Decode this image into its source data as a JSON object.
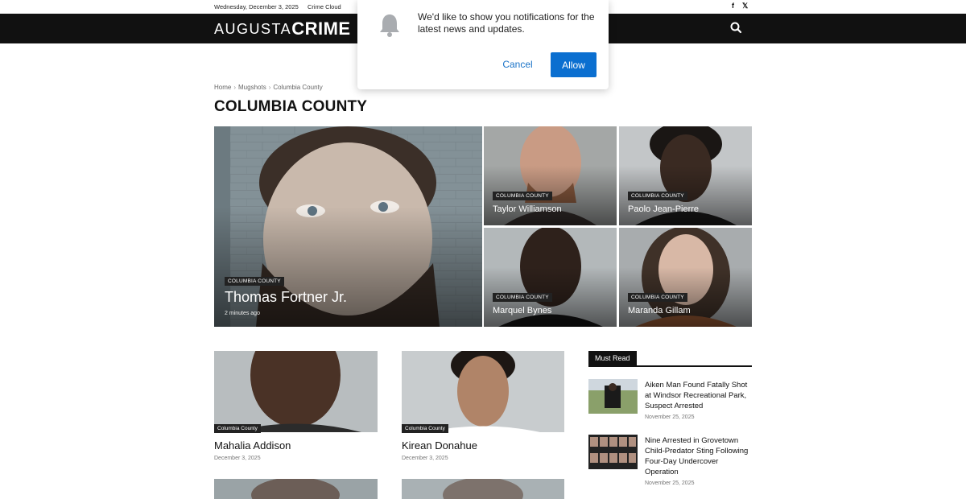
{
  "topbar": {
    "date": "Wednesday, December 3, 2025",
    "link": "Crime Cloud",
    "social_facebook": "f",
    "social_x": "𝕏"
  },
  "header": {
    "logo_part1": "AUGUSTA",
    "logo_part2": "CRIME"
  },
  "notification": {
    "message": "We'd like to show you notifications for the latest news and updates.",
    "cancel_label": "Cancel",
    "allow_label": "Allow"
  },
  "breadcrumb": {
    "home": "Home",
    "mugshots": "Mugshots",
    "current": "Columbia County"
  },
  "page_title": "COLUMBIA COUNTY",
  "featured": {
    "category": "COLUMBIA COUNTY",
    "name": "Thomas Fortner Jr.",
    "time": "2 minutes ago"
  },
  "grid": [
    {
      "category": "COLUMBIA COUNTY",
      "name": "Taylor Williamson"
    },
    {
      "category": "COLUMBIA COUNTY",
      "name": "Paolo Jean-Pierre"
    },
    {
      "category": "COLUMBIA COUNTY",
      "name": "Marquel Bynes"
    },
    {
      "category": "COLUMBIA COUNTY",
      "name": "Maranda Gillam"
    }
  ],
  "cards": [
    {
      "category": "Columbia County",
      "title": "Mahalia Addison",
      "date": "December 3, 2025"
    },
    {
      "category": "Columbia County",
      "title": "Kirean Donahue",
      "date": "December 3, 2025"
    }
  ],
  "sidebar": {
    "heading": "Must Read",
    "items": [
      {
        "title": "Aiken Man Found Fatally Shot at Windsor Recreational Park, Suspect Arrested",
        "date": "November 25, 2025"
      },
      {
        "title": "Nine Arrested in Grovetown Child-Predator Sting Following Four-Day Undercover Operation",
        "date": "November 25, 2025"
      }
    ]
  },
  "colors": {
    "header_bg": "#111111",
    "allow_button": "#0b6fd0",
    "cancel_text": "#1a73c8"
  }
}
